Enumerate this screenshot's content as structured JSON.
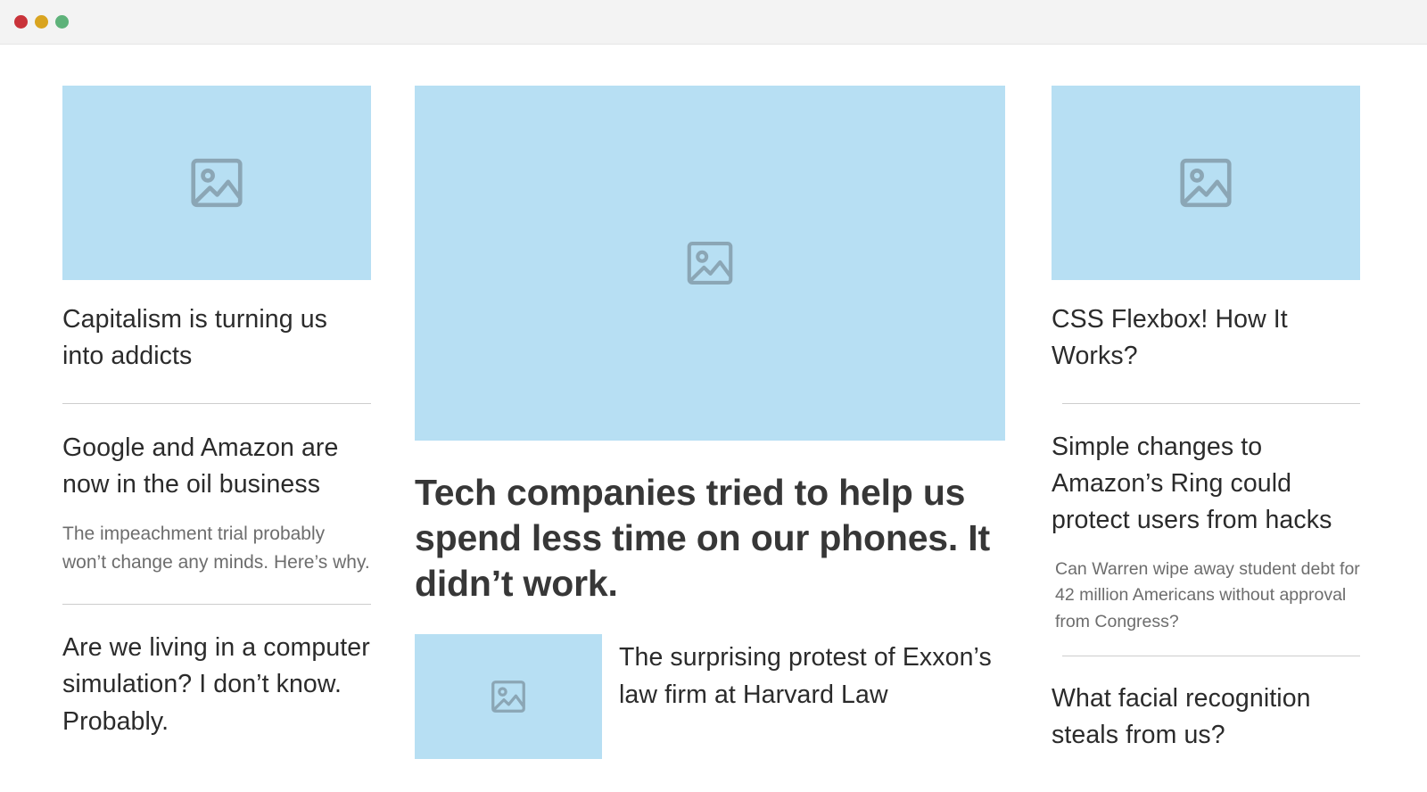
{
  "window": {
    "controls": [
      {
        "name": "close",
        "color": "#c9333a"
      },
      {
        "name": "minimize",
        "color": "#d9a420"
      },
      {
        "name": "maximize",
        "color": "#5eb27a"
      }
    ]
  },
  "theme": {
    "placeholder_fill": "#b7dff3",
    "placeholder_stroke": "#8ba6b5",
    "divider": "#cdcdcd",
    "headline_color": "#2b2b2b",
    "subtext_color": "#6d6d6d",
    "chrome_bg": "#f3f3f3",
    "page_bg": "#ffffff"
  },
  "icons": {
    "image_placeholder": "image-placeholder-icon"
  },
  "columns": {
    "left": {
      "image": {
        "alt": "image-placeholder"
      },
      "items": [
        {
          "headline": "Capitalism is turning us into addicts"
        },
        {
          "headline": "Google and Amazon are now in the oil business",
          "subtext": "The impeachment trial probably won’t change any minds. Here’s why."
        },
        {
          "headline": "Are we living in a computer simulation? I don’t know. Probably."
        }
      ]
    },
    "center": {
      "hero_image": {
        "alt": "image-placeholder"
      },
      "hero_headline": "Tech companies tried to help us spend less time on our phones. It didn’t work.",
      "items": [
        {
          "thumbnail": {
            "alt": "image-placeholder"
          },
          "headline": "The surprising protest of Exxon’s law firm at Harvard Law"
        }
      ]
    },
    "right": {
      "image": {
        "alt": "image-placeholder"
      },
      "items": [
        {
          "headline": "CSS Flexbox! How It Works?"
        },
        {
          "headline": "Simple changes to Amazon’s Ring could protect users from hacks",
          "subtext": "Can Warren wipe away student debt for 42 million Americans without approval from Congress?"
        },
        {
          "headline": "What facial recognition steals from us?"
        }
      ]
    }
  }
}
